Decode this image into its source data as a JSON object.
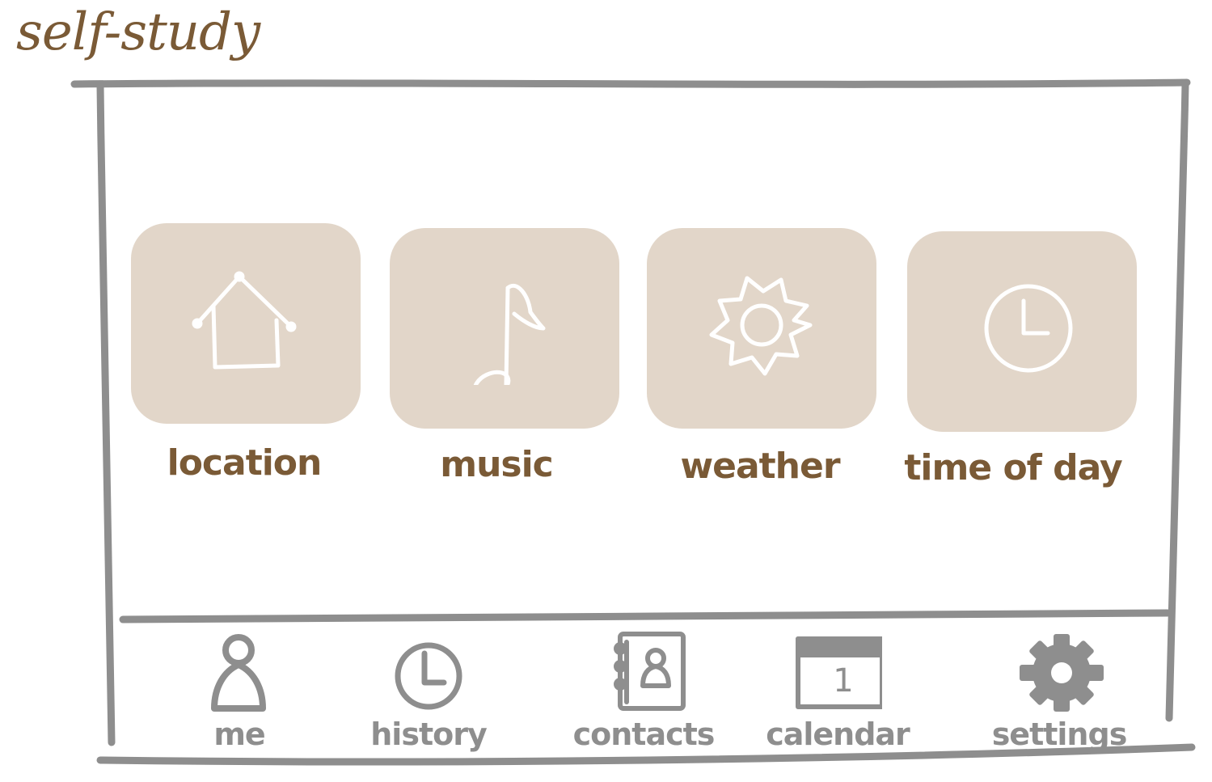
{
  "app": {
    "title": "self-study"
  },
  "colors": {
    "title": "#7a5a36",
    "tile_background": "#e2d6c9",
    "tile_icon": "#ffffff",
    "frame": "#8e8e8e",
    "nav": "#8e8e8e"
  },
  "tiles": [
    {
      "label": "location",
      "icon": "house-icon"
    },
    {
      "label": "music",
      "icon": "music-note-icon"
    },
    {
      "label": "weather",
      "icon": "sun-icon"
    },
    {
      "label": "time of day",
      "icon": "clock-icon"
    }
  ],
  "nav": [
    {
      "label": "me",
      "icon": "person-icon"
    },
    {
      "label": "history",
      "icon": "clock-icon"
    },
    {
      "label": "contacts",
      "icon": "address-book-icon"
    },
    {
      "label": "calendar",
      "icon": "calendar-icon",
      "icon_text": "1"
    },
    {
      "label": "settings",
      "icon": "gear-icon"
    }
  ]
}
